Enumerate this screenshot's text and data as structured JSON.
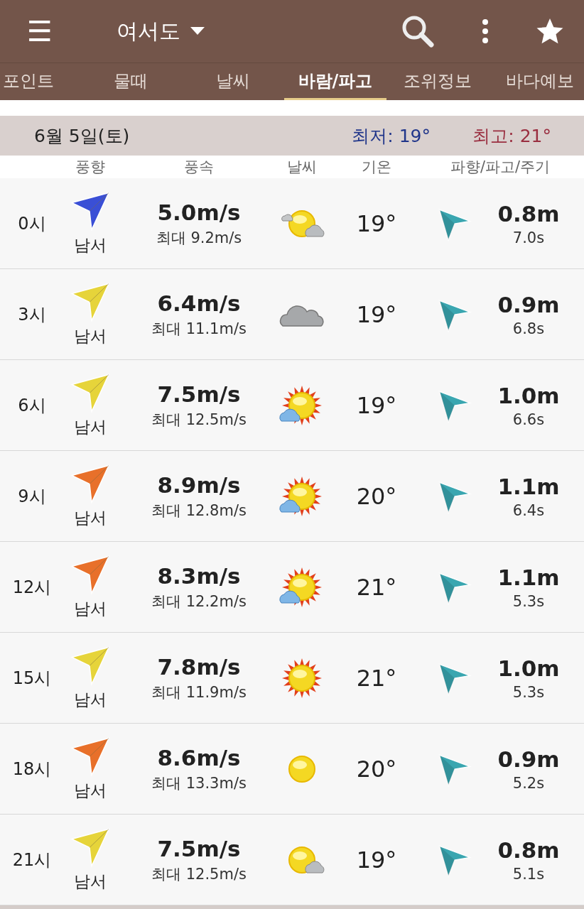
{
  "app_bar": {
    "location": "여서도",
    "menu_icon": "☰"
  },
  "tabs": [
    {
      "label": "포인트",
      "selected": false
    },
    {
      "label": "물때",
      "selected": false
    },
    {
      "label": "날씨",
      "selected": false
    },
    {
      "label": "바람/파고",
      "selected": true
    },
    {
      "label": "조위정보",
      "selected": false
    },
    {
      "label": "바다예보",
      "selected": false
    }
  ],
  "day": {
    "date": "6월 5일(토)",
    "low": "최저: 19°",
    "high": "최고: 21°"
  },
  "columns": [
    "풍향",
    "풍속",
    "날씨",
    "기온",
    "파향/파고/주기"
  ],
  "rows": [
    {
      "time": "0시",
      "color": "#3a4fd6",
      "wind_dir": "남서",
      "speed": "5.0m/s",
      "max": "최대 9.2m/s",
      "kind": "sun-cloud",
      "temp": "19°",
      "wave": "0.8m",
      "period": "7.0s"
    },
    {
      "time": "3시",
      "color": "#e6d43a",
      "wind_dir": "남서",
      "speed": "6.4m/s",
      "max": "최대 11.1m/s",
      "kind": "cloud",
      "temp": "19°",
      "wave": "0.9m",
      "period": "6.8s"
    },
    {
      "time": "6시",
      "color": "#e6d43a",
      "wind_dir": "남서",
      "speed": "7.5m/s",
      "max": "최대 12.5m/s",
      "kind": "rays-cloud",
      "temp": "19°",
      "wave": "1.0m",
      "period": "6.6s"
    },
    {
      "time": "9시",
      "color": "#e8702a",
      "wind_dir": "남서",
      "speed": "8.9m/s",
      "max": "최대 12.8m/s",
      "kind": "rays-cloud",
      "temp": "20°",
      "wave": "1.1m",
      "period": "6.4s"
    },
    {
      "time": "12시",
      "color": "#e8702a",
      "wind_dir": "남서",
      "speed": "8.3m/s",
      "max": "최대 12.2m/s",
      "kind": "rays-cloud",
      "temp": "21°",
      "wave": "1.1m",
      "period": "5.3s"
    },
    {
      "time": "15시",
      "color": "#e6d43a",
      "wind_dir": "남서",
      "speed": "7.8m/s",
      "max": "최대 11.9m/s",
      "kind": "rays",
      "temp": "21°",
      "wave": "1.0m",
      "period": "5.3s"
    },
    {
      "time": "18시",
      "color": "#e8702a",
      "wind_dir": "남서",
      "speed": "8.6m/s",
      "max": "최대 13.3m/s",
      "kind": "sun",
      "temp": "20°",
      "wave": "0.9m",
      "period": "5.2s"
    },
    {
      "time": "21시",
      "color": "#e6d43a",
      "wind_dir": "남서",
      "speed": "7.5m/s",
      "max": "최대 12.5m/s",
      "kind": "sun-small-cloud",
      "temp": "19°",
      "wave": "0.8m",
      "period": "5.1s"
    }
  ]
}
